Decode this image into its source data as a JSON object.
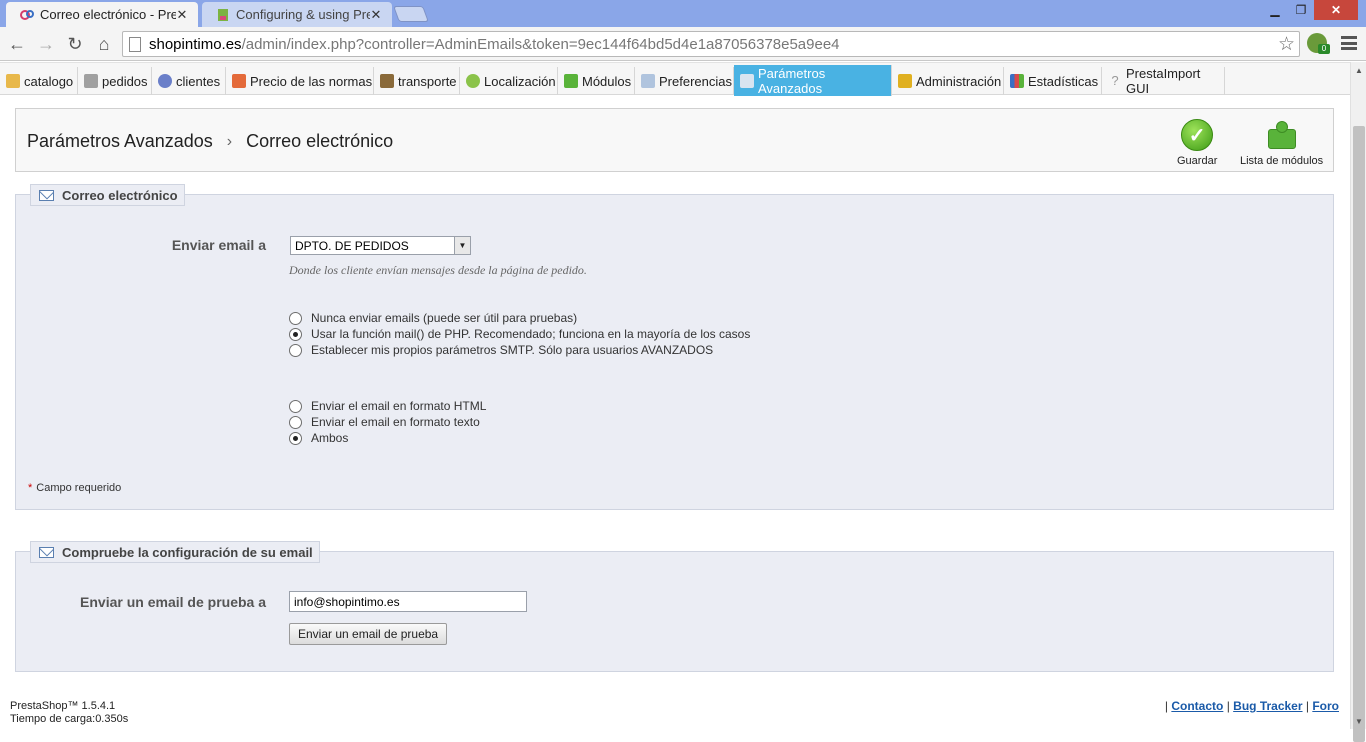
{
  "browser": {
    "tabs": [
      {
        "title": "Correo electrónico - Presta",
        "active": true
      },
      {
        "title": "Configuring & using Presta",
        "active": false
      }
    ],
    "url": {
      "host": "shopintimo.es",
      "path": "/admin/index.php?controller=AdminEmails&token=9ec144f64bd5d4e1a87056378e5a9ee4"
    },
    "extension_badge": "0"
  },
  "admin_menu": {
    "items": [
      {
        "label": "catalogo",
        "icon": "folder-icon"
      },
      {
        "label": "pedidos",
        "icon": "cart-icon"
      },
      {
        "label": "clientes",
        "icon": "user-icon"
      },
      {
        "label": "Precio de las normas",
        "icon": "price-icon"
      },
      {
        "label": "transporte",
        "icon": "truck-icon"
      },
      {
        "label": "Localización",
        "icon": "globe-icon"
      },
      {
        "label": "Módulos",
        "icon": "puzzle-icon"
      },
      {
        "label": "Preferencias",
        "icon": "preferences-icon"
      },
      {
        "label": "Parámetros Avanzados",
        "icon": "wrench-icon",
        "active": true
      },
      {
        "label": "Administración",
        "icon": "key-icon"
      },
      {
        "label": "Estadísticas",
        "icon": "stats-icon"
      },
      {
        "label": "PrestaImport GUI",
        "icon": "question-icon"
      }
    ]
  },
  "header": {
    "breadcrumb_parent": "Parámetros Avanzados",
    "breadcrumb_current": "Correo electrónico",
    "save_label": "Guardar",
    "modules_label": "Lista de módulos"
  },
  "email_section": {
    "legend": "Correo electrónico",
    "send_to_label": "Enviar email a",
    "send_to_value": "DPTO. DE PEDIDOS",
    "send_to_hint": "Donde los cliente envían mensajes desde la página de pedido.",
    "method_options": [
      {
        "label": "Nunca enviar emails (puede ser útil para pruebas)",
        "checked": false
      },
      {
        "label": "Usar la función mail() de PHP. Recomendado; funciona en la mayoría de los casos",
        "checked": true
      },
      {
        "label": "Establecer mis propios parámetros SMTP. Sólo para usuarios AVANZADOS",
        "checked": false
      }
    ],
    "format_options": [
      {
        "label": "Enviar el email en formato HTML",
        "checked": false
      },
      {
        "label": "Enviar el email en formato texto",
        "checked": false
      },
      {
        "label": "Ambos",
        "checked": true
      }
    ],
    "required_note": "Campo requerido"
  },
  "test_section": {
    "legend": "Compruebe la configuración de su email",
    "label": "Enviar un email de prueba a",
    "email_value": "info@shopintimo.es",
    "button_label": "Enviar un email de prueba"
  },
  "footer": {
    "version": "PrestaShop™ 1.5.4.1",
    "load_time": "Tiempo de carga:0.350s",
    "links": [
      "Contacto",
      "Bug Tracker",
      "Foro"
    ]
  }
}
